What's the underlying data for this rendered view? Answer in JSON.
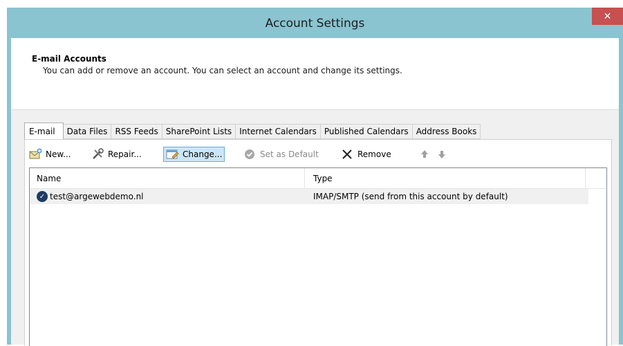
{
  "window": {
    "title": "Account Settings",
    "close_label": "✕"
  },
  "header": {
    "title": "E-mail Accounts",
    "description": "You can add or remove an account. You can select an account and change its settings."
  },
  "tabs": [
    {
      "label": "E-mail",
      "active": true
    },
    {
      "label": "Data Files",
      "active": false
    },
    {
      "label": "RSS Feeds",
      "active": false
    },
    {
      "label": "SharePoint Lists",
      "active": false
    },
    {
      "label": "Internet Calendars",
      "active": false
    },
    {
      "label": "Published Calendars",
      "active": false
    },
    {
      "label": "Address Books",
      "active": false
    }
  ],
  "toolbar": {
    "new_label": "New...",
    "repair_label": "Repair...",
    "change_label": "Change...",
    "set_default_label": "Set as Default",
    "remove_label": "Remove",
    "icons": {
      "new": "new-account-icon",
      "repair": "repair-tools-icon",
      "change": "change-settings-icon",
      "set_default": "check-circle-icon",
      "remove": "x-icon",
      "up": "arrow-up-icon",
      "down": "arrow-down-icon"
    }
  },
  "list": {
    "columns": [
      "Name",
      "Type"
    ],
    "rows": [
      {
        "name": "test@argewebdemo.nl",
        "type": "IMAP/SMTP (send from this account by default)",
        "default": true
      }
    ]
  },
  "colors": {
    "titlebar": "#8ac4d0",
    "close": "#c75050",
    "selection": "#cde6f7"
  }
}
